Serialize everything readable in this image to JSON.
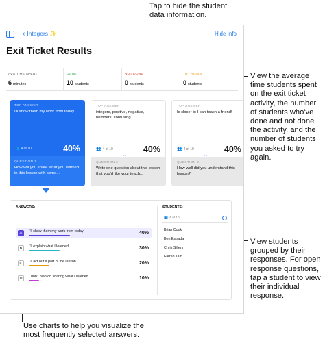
{
  "callouts": {
    "top": "Tap to hide the student data information.",
    "stats": "View the average time students spent on the exit ticket activity, the number of students who've done and not done the activity, and the number of students you asked to try again.",
    "students": "View students grouped by their responses. For open response questions, tap a student to view their individual response.",
    "charts": "Use charts to help you visualize the most frequently selected answers."
  },
  "nav": {
    "back_label": "Integers ✨",
    "hide_info": "Hide Info",
    "title": "Exit Ticket Results"
  },
  "stats": [
    {
      "label": "AVG TIME SPENT",
      "value": "6",
      "unit": "minutes",
      "color": "#555555"
    },
    {
      "label": "DONE",
      "value": "10",
      "unit": "students",
      "color": "#2e9e4a"
    },
    {
      "label": "NOT DONE",
      "value": "0",
      "unit": "students",
      "color": "#e0372f"
    },
    {
      "label": "TRY AGAIN",
      "value": "0",
      "unit": "students",
      "color": "#e8980c"
    }
  ],
  "cards": [
    {
      "label": "TOP ANSWER",
      "answer": "I'll show them my work from today",
      "count": "4 of 10",
      "pct": "40%",
      "q_label": "QUESTION 1",
      "question": "How will you share what you learned in this lesson with some..."
    },
    {
      "label": "TOP ANSWER",
      "answer": "integers, positive, negative, numbers, confusing",
      "count": "4 of 10",
      "pct": "40%",
      "q_label": "QUESTION 2",
      "question": "Write one question about this lesson that you'd like your teach..."
    },
    {
      "label": "TOP ANSWER",
      "answer": "Is closer to I can teach a friend!",
      "count": "4 of 10",
      "pct": "40%",
      "q_label": "QUESTION 3",
      "question": "How well did you understand this lesson?"
    }
  ],
  "answers_panel": {
    "heading": "ANSWERS:",
    "students_heading": "STUDENTS:",
    "students_count": "4 of 10",
    "answers": [
      {
        "letter": "A",
        "text": "I'll show them my work from today",
        "pct": "40%",
        "fraction": 0.4,
        "color": "#5a3fd8"
      },
      {
        "letter": "B",
        "text": "I'll explain what I learned",
        "pct": "30%",
        "fraction": 0.3,
        "color": "#2ab3c2"
      },
      {
        "letter": "C",
        "text": "I'll act out a part of the lesson",
        "pct": "20%",
        "fraction": 0.2,
        "color": "#e8980c"
      },
      {
        "letter": "D",
        "text": "I don't plan on sharing what I learned",
        "pct": "10%",
        "fraction": 0.1,
        "color": "#c23bd6"
      }
    ],
    "students": [
      "Brian Cook",
      "Ben Estrada",
      "Chris Sillers",
      "Farrah Tam"
    ]
  }
}
